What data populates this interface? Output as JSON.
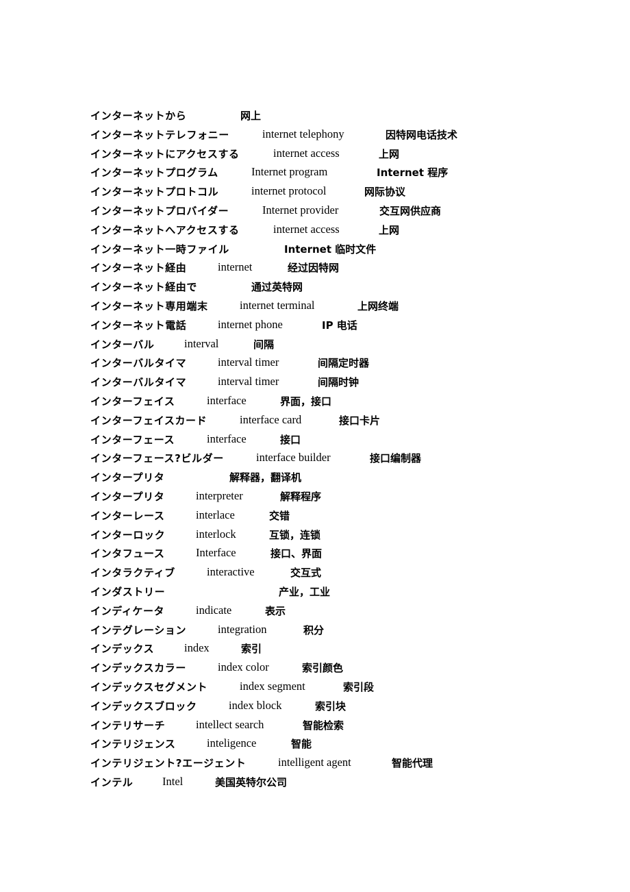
{
  "document": {
    "entries": [
      {
        "jp": "インターネットから",
        "en": "",
        "zh": "网上"
      },
      {
        "jp": "インターネットテレフォニー",
        "en": "internet telephony",
        "zh": "因特网电话技术"
      },
      {
        "jp": "インターネットにアクセスする",
        "en": "internet access",
        "zh": "上网"
      },
      {
        "jp": "インターネットプログラム",
        "en": "Internet   program",
        "zh": "Internet 程序"
      },
      {
        "jp": "インターネットプロトコル",
        "en": "internet protocol",
        "zh": "网际协议"
      },
      {
        "jp": "インターネットプロバイダー",
        "en": "Internet provider",
        "zh": "交互网供应商"
      },
      {
        "jp": "インターネットへアクセスする",
        "en": "internet access",
        "zh": "上网"
      },
      {
        "jp": "インターネット一時ファイル",
        "en": "",
        "zh": "Internet 临时文件"
      },
      {
        "jp": "インターネット経由",
        "en": "internet",
        "zh": "经过因特网"
      },
      {
        "jp": "インターネット経由で",
        "en": "",
        "zh": "通过英特网"
      },
      {
        "jp": "インターネット専用端末",
        "en": "internet terminal",
        "zh": "上网终端"
      },
      {
        "jp": "インターネット電話",
        "en": "internet phone",
        "zh": "IP 电话"
      },
      {
        "jp": "インターバル",
        "en": "interval",
        "zh": "间隔"
      },
      {
        "jp": "インターバルタイマ",
        "en": "interval timer",
        "zh": "间隔定时器"
      },
      {
        "jp": "インターバルタイマ",
        "en": "interval timer",
        "zh": "间隔时钟"
      },
      {
        "jp": "インターフェイス",
        "en": "interface",
        "zh": "界面，接口"
      },
      {
        "jp": "インターフェイスカード",
        "en": "interface card",
        "zh": "接口卡片"
      },
      {
        "jp": "インターフェース",
        "en": "interface",
        "zh": "接口"
      },
      {
        "jp": "インターフェース?ビルダー",
        "en": "interface builder",
        "zh": "接口编制器"
      },
      {
        "jp": "インタープリタ",
        "en": "",
        "zh": "解释器，翻译机"
      },
      {
        "jp": "インタープリタ",
        "en": "interpreter",
        "zh": "解释程序"
      },
      {
        "jp": "インターレース",
        "en": "interlace",
        "zh": "交错"
      },
      {
        "jp": "インターロック",
        "en": "interlock",
        "zh": "互锁，连锁"
      },
      {
        "jp": "インタフュース",
        "en": "Interface",
        "zh": "接口、界面"
      },
      {
        "jp": "インタラクティブ",
        "en": "interactive",
        "zh": "交互式"
      },
      {
        "jp": "インダストリー",
        "en": "",
        "zh": "产业，工业"
      },
      {
        "jp": "インディケータ",
        "en": "indicate",
        "zh": "表示"
      },
      {
        "jp": "インテグレーション",
        "en": "integration",
        "zh": "积分"
      },
      {
        "jp": "インデックス",
        "en": "index",
        "zh": "索引"
      },
      {
        "jp": "インデックスカラー",
        "en": "index color",
        "zh": "索引颜色"
      },
      {
        "jp": "インデックスセグメント",
        "en": "index segment",
        "zh": "索引段"
      },
      {
        "jp": "インデックスブロック",
        "en": "index block",
        "zh": "索引块"
      },
      {
        "jp": "インテリサーチ",
        "en": "intellect search",
        "zh": "智能检索"
      },
      {
        "jp": "インテリジェンス",
        "en": "inteligence",
        "zh": "智能"
      },
      {
        "jp": "インテリジェント?エージェント",
        "en": "intelligent agent",
        "zh": "智能代理"
      },
      {
        "jp": "インテル",
        "en": "Intel",
        "zh": "美国英特尔公司"
      }
    ]
  }
}
